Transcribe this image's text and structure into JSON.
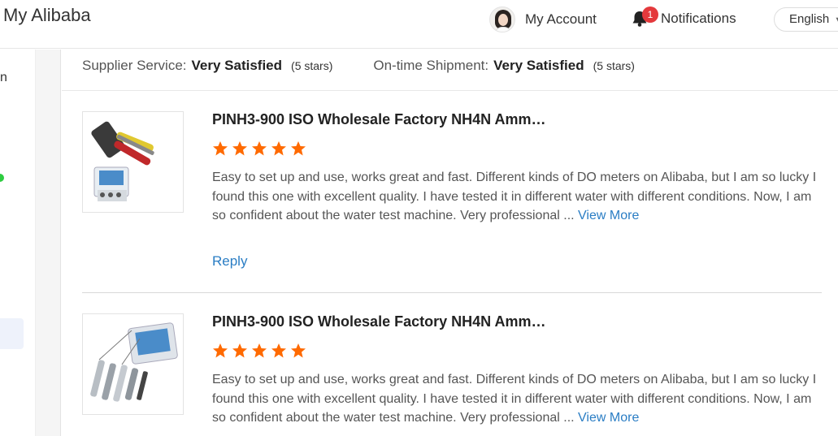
{
  "header": {
    "brand": "My Alibaba",
    "account_label": "My Account",
    "notifications_label": "Notifications",
    "notifications_count": "1",
    "language": "English"
  },
  "sidebar": {
    "partial_letter": "n"
  },
  "ratings": {
    "supplier_label": "Supplier Service:",
    "supplier_value": "Very Satisfied",
    "supplier_stars": "(5 stars)",
    "shipment_label": "On-time Shipment:",
    "shipment_value": "Very Satisfied",
    "shipment_stars": "(5 stars)"
  },
  "reviews": [
    {
      "title": "PINH3-900 ISO Wholesale Factory NH4N Amm…",
      "rating": 5,
      "body": "Easy to set up and use, works great and fast. Different kinds of DO meters on Alibaba, but I am so lucky I found this one with excellent quality. I have tested it in different water with different conditions. Now, I am so confident about the water test machine. Very professional ...",
      "view_more": "View More",
      "reply": "Reply"
    },
    {
      "title": "PINH3-900 ISO Wholesale Factory NH4N Amm…",
      "rating": 5,
      "body": "Easy to set up and use, works great and fast. Different kinds of DO meters on Alibaba, but I am so lucky I found this one with excellent quality. I have tested it in different water with different conditions. Now, I am so confident about the water test machine. Very professional ...",
      "view_more": "View More"
    }
  ],
  "colors": {
    "star": "#ff6a00",
    "link": "#2a7dc4",
    "badge": "#e4393c"
  },
  "icons": {
    "star": "star-icon",
    "bell": "bell-icon",
    "language_chevron": "chevron-down-icon"
  }
}
